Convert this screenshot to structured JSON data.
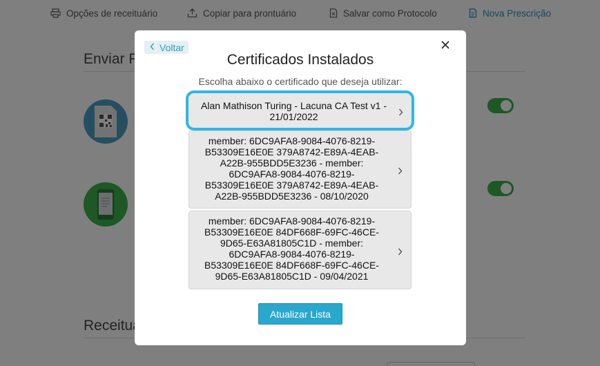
{
  "toolbar": {
    "items": [
      {
        "label": "Opções de receituário",
        "icon": "printer-icon"
      },
      {
        "label": "Copiar para prontuário",
        "icon": "upload-icon"
      },
      {
        "label": "Salvar como Protocolo",
        "icon": "document-icon"
      },
      {
        "label": "Nova Prescrição",
        "icon": "new-document-icon"
      }
    ],
    "active_color": "#2196c0"
  },
  "background": {
    "send_title": "Enviar R",
    "prescriptions_title": "Receitua"
  },
  "modal": {
    "back_label": "Voltar",
    "title": "Certificados Instalados",
    "subtitle": "Escolha abaixo o certificado que deseja utilizar:",
    "certificates": [
      {
        "lines": [
          "Alan Mathison Turing - Lacuna CA Test v1 -",
          "21/01/2022"
        ],
        "selected": true
      },
      {
        "lines": [
          "member: 6DC9AFA8-9084-4076-8219-",
          "B53309E16E0E 379A8742-E89A-4EAB-",
          "A22B-955BDD5E3236 - member:",
          "6DC9AFA8-9084-4076-8219-",
          "B53309E16E0E 379A8742-E89A-4EAB-",
          "A22B-955BDD5E3236 - 08/10/2020"
        ],
        "selected": false
      },
      {
        "lines": [
          "member: 6DC9AFA8-9084-4076-8219-",
          "B53309E16E0E 84DF668F-69FC-46CE-",
          "9D65-E63A81805C1D - member:",
          "6DC9AFA8-9084-4076-8219-",
          "B53309E16E0E 84DF668F-69FC-46CE-",
          "9D65-E63A81805C1D - 09/04/2021"
        ],
        "selected": false
      }
    ],
    "refresh_label": "Atualizar Lista",
    "accent_color": "#2aa7cd",
    "selection_color": "#2fb6e8"
  }
}
